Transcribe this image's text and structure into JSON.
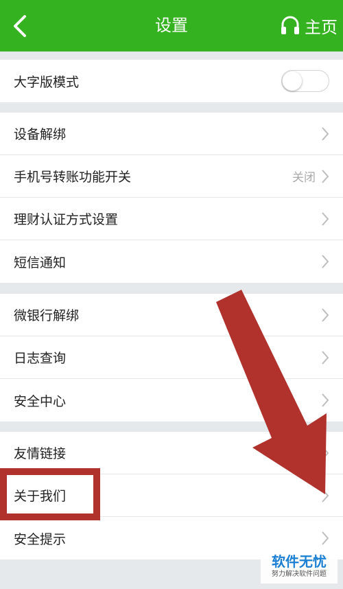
{
  "header": {
    "title": "设置",
    "home_label": "主页"
  },
  "groups": [
    {
      "rows": [
        {
          "label": "大字版模式",
          "toggle": false
        }
      ]
    },
    {
      "rows": [
        {
          "label": "设备解绑"
        },
        {
          "label": "手机号转账功能开关",
          "value": "关闭"
        },
        {
          "label": "理财认证方式设置"
        },
        {
          "label": "短信通知"
        }
      ]
    },
    {
      "rows": [
        {
          "label": "微银行解绑"
        },
        {
          "label": "日志查询"
        },
        {
          "label": "安全中心"
        }
      ]
    },
    {
      "rows": [
        {
          "label": "友情链接"
        },
        {
          "label": "关于我们"
        },
        {
          "label": "安全提示"
        }
      ]
    }
  ],
  "icons": {
    "back": "chevron-left-icon",
    "home": "headset-icon",
    "row": "chevron-right-icon"
  },
  "colors": {
    "header": "#35b21f",
    "annotation": "#b1312d",
    "watermark": "#1b7fd4"
  },
  "watermark": {
    "title": "软件无忧",
    "subtitle": "努力解决软件问题"
  }
}
